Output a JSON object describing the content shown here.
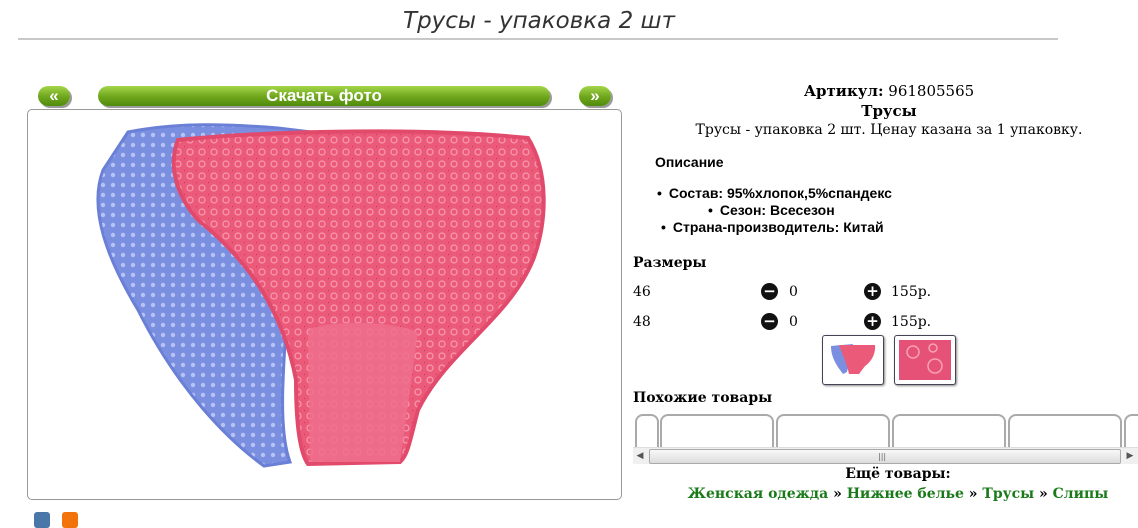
{
  "title": "Трусы - упаковка 2 шт",
  "gallery": {
    "prev_label": "«",
    "download_label": "Скачать фото",
    "next_label": "»"
  },
  "product": {
    "article_label": "Артикул:",
    "article_value": "961805565",
    "name": "Трусы",
    "description": "Трусы - упаковка 2 шт. Ценау казана за 1 упаковку."
  },
  "description_heading": "Описание",
  "features": [
    "Состав: 95%хлопок,5%спандекс",
    "Сезон: Всесезон",
    "Страна-производитель: Китай"
  ],
  "sizes_heading": "Размеры",
  "sizes": [
    {
      "size": "46",
      "qty": "0",
      "price": "155р."
    },
    {
      "size": "48",
      "qty": "0",
      "price": "155р."
    }
  ],
  "similar_heading": "Похожие товары",
  "more_heading": "Ещё товары:",
  "breadcrumbs": [
    "Женская одежда",
    "Нижнее белье",
    "Трусы",
    "Слипы"
  ],
  "breadcrumb_separator": "»",
  "colors": {
    "accent_green": "#6ea51c",
    "link_green": "#1a7a1a",
    "product_pink": "#ec5a7a",
    "product_blue": "#7b8fe0"
  }
}
